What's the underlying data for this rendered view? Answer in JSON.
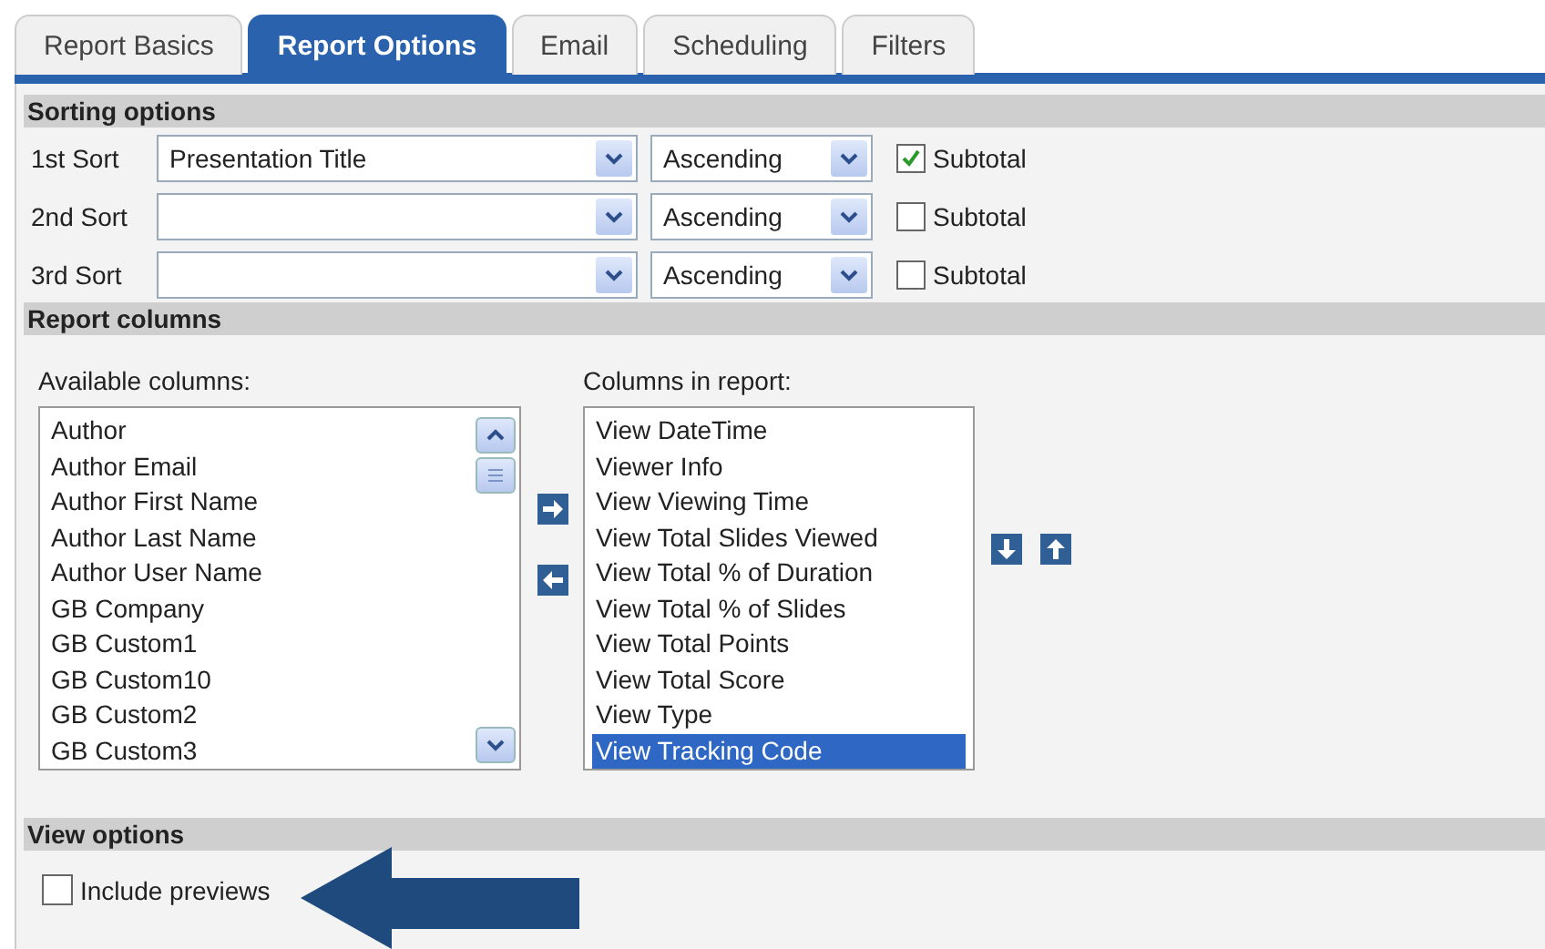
{
  "tabs": [
    {
      "label": "Report Basics",
      "selected": false
    },
    {
      "label": "Report Options",
      "selected": true
    },
    {
      "label": "Email",
      "selected": false
    },
    {
      "label": "Scheduling",
      "selected": false
    },
    {
      "label": "Filters",
      "selected": false
    }
  ],
  "sorting": {
    "title": "Sorting options",
    "rows": [
      {
        "label": "1st Sort",
        "field": "Presentation Title",
        "order": "Ascending",
        "subtotal_label": "Subtotal",
        "subtotal": true
      },
      {
        "label": "2nd Sort",
        "order": "Ascending",
        "subtotal_label": "Subtotal",
        "subtotal": false
      },
      {
        "label": "3rd Sort",
        "order": "Ascending",
        "subtotal_label": "Subtotal",
        "subtotal": false
      }
    ]
  },
  "report_columns": {
    "title": "Report columns",
    "available": {
      "label": "Available columns:",
      "items": [
        {
          "label": "Author",
          "selected": false
        },
        {
          "label": "Author Email",
          "selected": false
        },
        {
          "label": "Author First Name",
          "selected": false
        },
        {
          "label": "Author Last Name",
          "selected": false
        },
        {
          "label": "Author User Name",
          "selected": false
        },
        {
          "label": "GB Company",
          "selected": false
        },
        {
          "label": "GB Custom1",
          "selected": false
        },
        {
          "label": "GB Custom10",
          "selected": false
        },
        {
          "label": "GB Custom2",
          "selected": false
        },
        {
          "label": "GB Custom3",
          "selected": false
        }
      ]
    },
    "in_report": {
      "label": "Columns in report:",
      "items": [
        {
          "label": "View DateTime",
          "selected": false
        },
        {
          "label": "Viewer Info",
          "selected": false
        },
        {
          "label": "View Viewing Time",
          "selected": false
        },
        {
          "label": "View Total Slides Viewed",
          "selected": false
        },
        {
          "label": "View Total % of Duration",
          "selected": false
        },
        {
          "label": "View Total % of Slides",
          "selected": false
        },
        {
          "label": "View Total Points",
          "selected": false
        },
        {
          "label": "View Total Score",
          "selected": false
        },
        {
          "label": "View Type",
          "selected": false
        },
        {
          "label": "View Tracking Code",
          "selected": true
        }
      ]
    }
  },
  "view_options": {
    "title": "View options",
    "include_previews_label": "Include previews",
    "include_previews": false
  }
}
